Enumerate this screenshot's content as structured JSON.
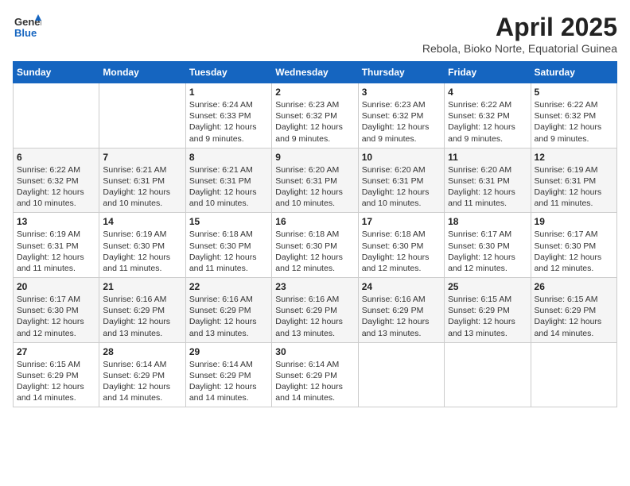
{
  "header": {
    "logo_general": "General",
    "logo_blue": "Blue",
    "month_title": "April 2025",
    "location": "Rebola, Bioko Norte, Equatorial Guinea"
  },
  "days_of_week": [
    "Sunday",
    "Monday",
    "Tuesday",
    "Wednesday",
    "Thursday",
    "Friday",
    "Saturday"
  ],
  "weeks": [
    [
      {
        "day": "",
        "sunrise": "",
        "sunset": "",
        "daylight": ""
      },
      {
        "day": "",
        "sunrise": "",
        "sunset": "",
        "daylight": ""
      },
      {
        "day": "1",
        "sunrise": "Sunrise: 6:24 AM",
        "sunset": "Sunset: 6:33 PM",
        "daylight": "Daylight: 12 hours and 9 minutes."
      },
      {
        "day": "2",
        "sunrise": "Sunrise: 6:23 AM",
        "sunset": "Sunset: 6:32 PM",
        "daylight": "Daylight: 12 hours and 9 minutes."
      },
      {
        "day": "3",
        "sunrise": "Sunrise: 6:23 AM",
        "sunset": "Sunset: 6:32 PM",
        "daylight": "Daylight: 12 hours and 9 minutes."
      },
      {
        "day": "4",
        "sunrise": "Sunrise: 6:22 AM",
        "sunset": "Sunset: 6:32 PM",
        "daylight": "Daylight: 12 hours and 9 minutes."
      },
      {
        "day": "5",
        "sunrise": "Sunrise: 6:22 AM",
        "sunset": "Sunset: 6:32 PM",
        "daylight": "Daylight: 12 hours and 9 minutes."
      }
    ],
    [
      {
        "day": "6",
        "sunrise": "Sunrise: 6:22 AM",
        "sunset": "Sunset: 6:32 PM",
        "daylight": "Daylight: 12 hours and 10 minutes."
      },
      {
        "day": "7",
        "sunrise": "Sunrise: 6:21 AM",
        "sunset": "Sunset: 6:31 PM",
        "daylight": "Daylight: 12 hours and 10 minutes."
      },
      {
        "day": "8",
        "sunrise": "Sunrise: 6:21 AM",
        "sunset": "Sunset: 6:31 PM",
        "daylight": "Daylight: 12 hours and 10 minutes."
      },
      {
        "day": "9",
        "sunrise": "Sunrise: 6:20 AM",
        "sunset": "Sunset: 6:31 PM",
        "daylight": "Daylight: 12 hours and 10 minutes."
      },
      {
        "day": "10",
        "sunrise": "Sunrise: 6:20 AM",
        "sunset": "Sunset: 6:31 PM",
        "daylight": "Daylight: 12 hours and 10 minutes."
      },
      {
        "day": "11",
        "sunrise": "Sunrise: 6:20 AM",
        "sunset": "Sunset: 6:31 PM",
        "daylight": "Daylight: 12 hours and 11 minutes."
      },
      {
        "day": "12",
        "sunrise": "Sunrise: 6:19 AM",
        "sunset": "Sunset: 6:31 PM",
        "daylight": "Daylight: 12 hours and 11 minutes."
      }
    ],
    [
      {
        "day": "13",
        "sunrise": "Sunrise: 6:19 AM",
        "sunset": "Sunset: 6:31 PM",
        "daylight": "Daylight: 12 hours and 11 minutes."
      },
      {
        "day": "14",
        "sunrise": "Sunrise: 6:19 AM",
        "sunset": "Sunset: 6:30 PM",
        "daylight": "Daylight: 12 hours and 11 minutes."
      },
      {
        "day": "15",
        "sunrise": "Sunrise: 6:18 AM",
        "sunset": "Sunset: 6:30 PM",
        "daylight": "Daylight: 12 hours and 11 minutes."
      },
      {
        "day": "16",
        "sunrise": "Sunrise: 6:18 AM",
        "sunset": "Sunset: 6:30 PM",
        "daylight": "Daylight: 12 hours and 12 minutes."
      },
      {
        "day": "17",
        "sunrise": "Sunrise: 6:18 AM",
        "sunset": "Sunset: 6:30 PM",
        "daylight": "Daylight: 12 hours and 12 minutes."
      },
      {
        "day": "18",
        "sunrise": "Sunrise: 6:17 AM",
        "sunset": "Sunset: 6:30 PM",
        "daylight": "Daylight: 12 hours and 12 minutes."
      },
      {
        "day": "19",
        "sunrise": "Sunrise: 6:17 AM",
        "sunset": "Sunset: 6:30 PM",
        "daylight": "Daylight: 12 hours and 12 minutes."
      }
    ],
    [
      {
        "day": "20",
        "sunrise": "Sunrise: 6:17 AM",
        "sunset": "Sunset: 6:30 PM",
        "daylight": "Daylight: 12 hours and 12 minutes."
      },
      {
        "day": "21",
        "sunrise": "Sunrise: 6:16 AM",
        "sunset": "Sunset: 6:29 PM",
        "daylight": "Daylight: 12 hours and 13 minutes."
      },
      {
        "day": "22",
        "sunrise": "Sunrise: 6:16 AM",
        "sunset": "Sunset: 6:29 PM",
        "daylight": "Daylight: 12 hours and 13 minutes."
      },
      {
        "day": "23",
        "sunrise": "Sunrise: 6:16 AM",
        "sunset": "Sunset: 6:29 PM",
        "daylight": "Daylight: 12 hours and 13 minutes."
      },
      {
        "day": "24",
        "sunrise": "Sunrise: 6:16 AM",
        "sunset": "Sunset: 6:29 PM",
        "daylight": "Daylight: 12 hours and 13 minutes."
      },
      {
        "day": "25",
        "sunrise": "Sunrise: 6:15 AM",
        "sunset": "Sunset: 6:29 PM",
        "daylight": "Daylight: 12 hours and 13 minutes."
      },
      {
        "day": "26",
        "sunrise": "Sunrise: 6:15 AM",
        "sunset": "Sunset: 6:29 PM",
        "daylight": "Daylight: 12 hours and 14 minutes."
      }
    ],
    [
      {
        "day": "27",
        "sunrise": "Sunrise: 6:15 AM",
        "sunset": "Sunset: 6:29 PM",
        "daylight": "Daylight: 12 hours and 14 minutes."
      },
      {
        "day": "28",
        "sunrise": "Sunrise: 6:14 AM",
        "sunset": "Sunset: 6:29 PM",
        "daylight": "Daylight: 12 hours and 14 minutes."
      },
      {
        "day": "29",
        "sunrise": "Sunrise: 6:14 AM",
        "sunset": "Sunset: 6:29 PM",
        "daylight": "Daylight: 12 hours and 14 minutes."
      },
      {
        "day": "30",
        "sunrise": "Sunrise: 6:14 AM",
        "sunset": "Sunset: 6:29 PM",
        "daylight": "Daylight: 12 hours and 14 minutes."
      },
      {
        "day": "",
        "sunrise": "",
        "sunset": "",
        "daylight": ""
      },
      {
        "day": "",
        "sunrise": "",
        "sunset": "",
        "daylight": ""
      },
      {
        "day": "",
        "sunrise": "",
        "sunset": "",
        "daylight": ""
      }
    ]
  ]
}
